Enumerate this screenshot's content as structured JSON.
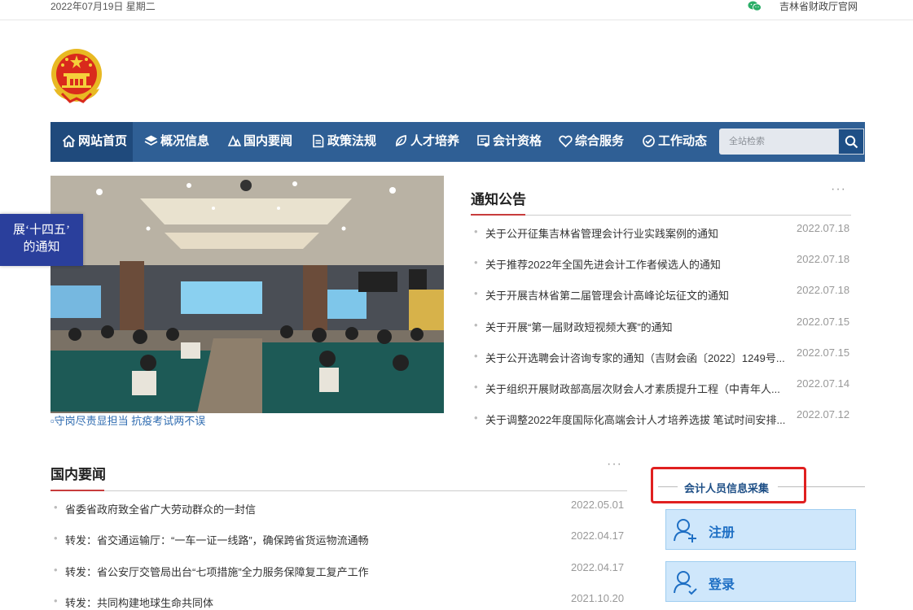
{
  "topbar": {
    "date": "2022年07月19日 星期二",
    "official_link": "吉林省财政厅官网",
    "wechat_icon": "wechat-icon"
  },
  "nav": {
    "items": [
      {
        "label": "网站首页",
        "icon": "home-icon"
      },
      {
        "label": "概况信息",
        "icon": "layers-icon"
      },
      {
        "label": "国内要闻",
        "icon": "news-icon"
      },
      {
        "label": "政策法规",
        "icon": "document-icon"
      },
      {
        "label": "人才培养",
        "icon": "leaf-icon"
      },
      {
        "label": "会计资格",
        "icon": "certificate-icon"
      },
      {
        "label": "综合服务",
        "icon": "heart-icon"
      },
      {
        "label": "工作动态",
        "icon": "settings-icon"
      }
    ],
    "search_placeholder": "全站检索"
  },
  "hero": {
    "caption": "守岗尽责显担当 抗疫考试两不误"
  },
  "float_tab": {
    "line1": "展‘十四五’",
    "line2": "的通知"
  },
  "notices": {
    "title": "通知公告",
    "more": "···",
    "items": [
      {
        "text": "关于公开征集吉林省管理会计行业实践案例的通知",
        "date": "2022.07.18"
      },
      {
        "text": "关于推荐2022年全国先进会计工作者候选人的通知",
        "date": "2022.07.18"
      },
      {
        "text": "关于开展吉林省第二届管理会计高峰论坛征文的通知",
        "date": "2022.07.18"
      },
      {
        "text": "关于开展“第一届财政短视频大赛”的通知",
        "date": "2022.07.15"
      },
      {
        "text": "关于公开选聘会计咨询专家的通知（吉财会函〔2022〕1249号...",
        "date": "2022.07.15"
      },
      {
        "text": "关于组织开展财政部高层次财会人才素质提升工程（中青年人...",
        "date": "2022.07.14"
      },
      {
        "text": "关于调整2022年度国际化高端会计人才培养选拔 笔试时间安排...",
        "date": "2022.07.12"
      }
    ]
  },
  "domestic": {
    "title": "国内要闻",
    "more": "···",
    "items": [
      {
        "text": "省委省政府致全省广大劳动群众的一封信",
        "date": "2022.05.01"
      },
      {
        "text": "转发：省交通运输厅：“一车一证一线路”，确保跨省货运物流通畅",
        "date": "2022.04.17"
      },
      {
        "text": "转发：省公安厅交管局出台“七项措施”全力服务保障复工复产工作",
        "date": "2022.04.17"
      },
      {
        "text": "转发：共同构建地球生命共同体",
        "date": "2021.10.20"
      }
    ]
  },
  "info": {
    "title": "会计人员信息采集",
    "register": "注册",
    "login": "登录"
  },
  "colors": {
    "nav_bg": "#2f5f95",
    "accent_red": "#c83c3c",
    "float_tab_bg": "#2a3f9c",
    "service_btn_bg": "#cfe7fb"
  }
}
